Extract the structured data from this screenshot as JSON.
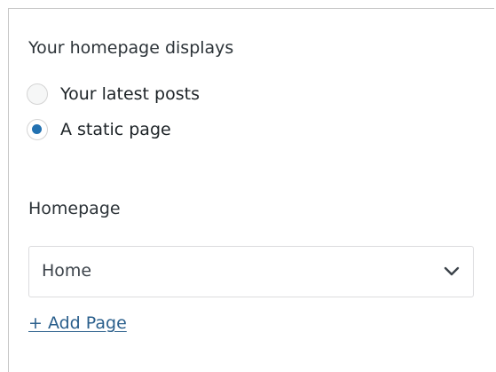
{
  "homepage_displays": {
    "heading": "Your homepage displays",
    "options": [
      {
        "label": "Your latest posts",
        "selected": false
      },
      {
        "label": "A static page",
        "selected": true
      }
    ]
  },
  "homepage": {
    "label": "Homepage",
    "selected_value": "Home",
    "add_link": "+ Add Page"
  },
  "icons": {
    "dropdown": "chevron-down-icon"
  },
  "colors": {
    "accent": "#2271b1",
    "link": "#2a5f8c",
    "text": "#2c3338",
    "border": "#dcdcde"
  }
}
